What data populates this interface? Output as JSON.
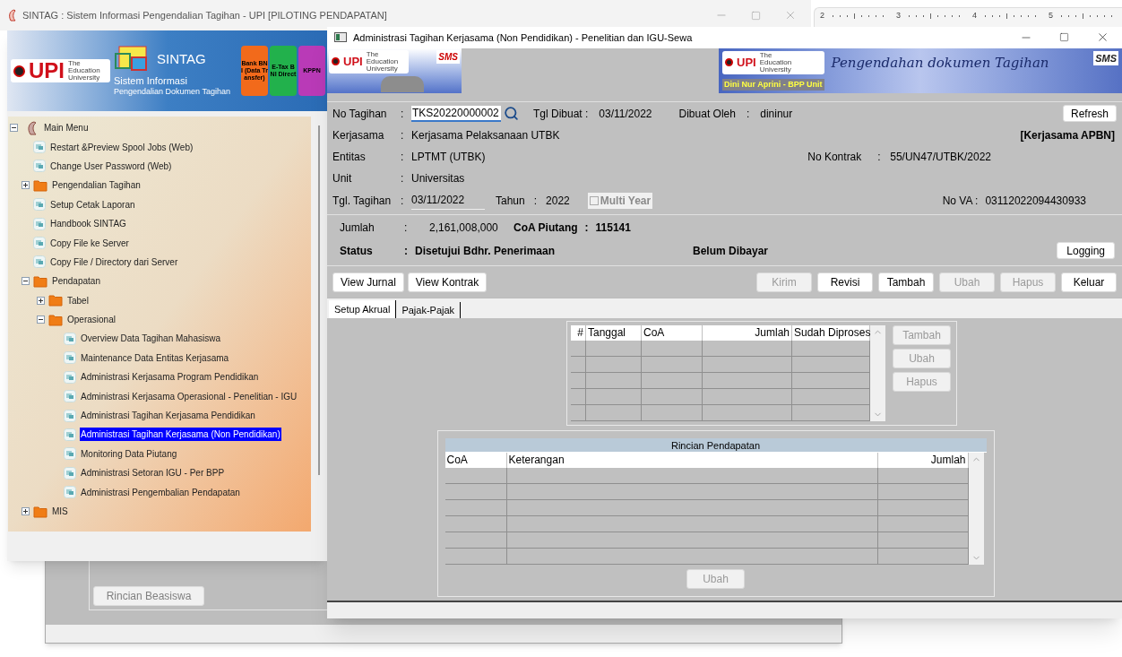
{
  "main_window": {
    "title": "SINTAG : Sistem Informasi Pengendalian Tagihan - UPI [PILOTING PENDAPATAN]",
    "banner": {
      "logo": "UPI",
      "logo_caption": "The Education University",
      "app_name": "SINTAG",
      "subtitle_1": "Sistem Informasi",
      "subtitle_2": "Pengendalian Dokumen Tagihan",
      "tiles": [
        {
          "label": "Bank BNI (Data Transfer)",
          "color": "#f26a1b"
        },
        {
          "label": "E-Tax BNI Direct",
          "color": "#22b14c"
        },
        {
          "label": "KPPN",
          "color": "#b93ab7"
        }
      ]
    },
    "tree": [
      {
        "label": "Main Menu",
        "kind": "root",
        "expanded": true,
        "selected": false,
        "children": [
          {
            "label": "Restart &Preview Spool Jobs (Web)",
            "kind": "page",
            "selected": false
          },
          {
            "label": "Change User Password (Web)",
            "kind": "page",
            "selected": false
          },
          {
            "label": "Pengendalian Tagihan",
            "kind": "folder",
            "expanded": false,
            "selected": false
          },
          {
            "label": "Setup Cetak Laporan",
            "kind": "page",
            "selected": false
          },
          {
            "label": "Handbook SINTAG",
            "kind": "page",
            "selected": false
          },
          {
            "label": "Copy File ke Server",
            "kind": "page",
            "selected": false
          },
          {
            "label": "Copy File / Directory dari Server",
            "kind": "page",
            "selected": false
          },
          {
            "label": "Pendapatan",
            "kind": "folder",
            "expanded": true,
            "selected": false,
            "children": [
              {
                "label": "Tabel",
                "kind": "folder",
                "expanded": false,
                "selected": false
              },
              {
                "label": "Operasional",
                "kind": "folder",
                "expanded": true,
                "selected": false,
                "children": [
                  {
                    "label": "Overview Data Tagihan Mahasiswa",
                    "kind": "page",
                    "selected": false
                  },
                  {
                    "label": "Maintenance Data Entitas Kerjasama",
                    "kind": "page",
                    "selected": false
                  },
                  {
                    "label": "Administrasi Kerjasama Program Pendidikan",
                    "kind": "page",
                    "selected": false
                  },
                  {
                    "label": "Administrasi Kerjasama Operasional - Penelitian - IGU",
                    "kind": "page",
                    "selected": false
                  },
                  {
                    "label": "Administrasi Tagihan Kerjasama Pendidikan",
                    "kind": "page",
                    "selected": false
                  },
                  {
                    "label": "Administrasi Tagihan Kerjasama (Non Pendidikan)",
                    "kind": "page",
                    "selected": true
                  },
                  {
                    "label": "Monitoring Data Piutang",
                    "kind": "page",
                    "selected": false
                  },
                  {
                    "label": "Administrasi Setoran IGU - Per BPP",
                    "kind": "page",
                    "selected": false
                  },
                  {
                    "label": "Administrasi Pengembalian Pendapatan",
                    "kind": "page",
                    "selected": false
                  }
                ]
              }
            ]
          },
          {
            "label": "MIS",
            "kind": "folder",
            "expanded": false,
            "selected": false
          }
        ]
      }
    ]
  },
  "background_window": {
    "button": {
      "label": "Rincian Beasiswa",
      "disabled": true
    }
  },
  "ruler": {
    "marks": [
      "2",
      "3",
      "4",
      "5"
    ]
  },
  "dialog": {
    "title": "Administrasi Tagihan Kerjasama (Non Pendidikan) - Penelitian dan IGU-Sewa",
    "left_banner": {
      "logo": "UPI",
      "logo_caption": "The Education University",
      "partner_logo": "SMS"
    },
    "right_banner": {
      "logo": "UPI",
      "logo_caption": "The Education University",
      "slogan": "Pengendahan dokumen Tagihan",
      "partner_logo": "SMS",
      "user": "Dini Nur Aprini - BPP Unit"
    },
    "no_tagihan": {
      "label": "No Tagihan",
      "colon": ":",
      "value": "TKS20220000002"
    },
    "tgl_dibuat": {
      "label": "Tgl Dibuat :",
      "value": "03/11/2022"
    },
    "dibuat_oleh": {
      "label": "Dibuat Oleh",
      "colon": ":",
      "value": "dininur"
    },
    "refresh_button": "Refresh",
    "kerjasama": {
      "label": "Kerjasama",
      "colon": ":",
      "value": "Kerjasama Pelaksanaan UTBK"
    },
    "kerjasama_type": "[Kerjasama APBN]",
    "entitas": {
      "label": "Entitas",
      "colon": ":",
      "value": "LPTMT (UTBK)"
    },
    "no_kontrak": {
      "label": "No Kontrak",
      "colon": ":",
      "value": "55/UN47/UTBK/2022"
    },
    "unit": {
      "label": "Unit",
      "colon": ":",
      "value": "Universitas"
    },
    "tgl_tagihan": {
      "label": "Tgl. Tagihan",
      "colon": ":",
      "value": "03/11/2022"
    },
    "tahun": {
      "label": "Tahun",
      "colon": ":",
      "value": "2022"
    },
    "multi_year": {
      "label": "Multi Year",
      "checked": false,
      "disabled": true
    },
    "no_va": {
      "label": "No VA :",
      "value": "03112022094430933"
    },
    "jumlah": {
      "label": "Jumlah",
      "colon": ":",
      "value": "2,161,008,000"
    },
    "coa_piutang": {
      "label": "CoA Piutang",
      "colon": ":",
      "value": "115141"
    },
    "status": {
      "label": "Status",
      "colon": ":",
      "value": "Disetujui Bdhr. Penerimaan",
      "payment": "Belum Dibayar"
    },
    "logging_button": "Logging",
    "left_buttons": [
      {
        "label": "View Jurnal",
        "disabled": false
      },
      {
        "label": "View Kontrak",
        "disabled": false
      }
    ],
    "right_buttons": [
      {
        "label": "Kirim",
        "disabled": true
      },
      {
        "label": "Revisi",
        "disabled": false
      },
      {
        "label": "Tambah",
        "disabled": false
      },
      {
        "label": "Ubah",
        "disabled": true
      },
      {
        "label": "Hapus",
        "disabled": true
      },
      {
        "label": "Keluar",
        "disabled": false
      }
    ],
    "tabs": [
      {
        "label": "Setup Akrual",
        "selected": true
      },
      {
        "label": "Pajak-Pajak",
        "selected": false
      }
    ],
    "akrual_table": {
      "columns": [
        {
          "label": "#",
          "kind": "number"
        },
        {
          "label": "Tanggal",
          "kind": "text"
        },
        {
          "label": "CoA",
          "kind": "text"
        },
        {
          "label": "Jumlah",
          "kind": "number"
        },
        {
          "label": "Sudah Diproses",
          "kind": "text"
        }
      ],
      "buttons": [
        {
          "label": "Tambah",
          "disabled": true
        },
        {
          "label": "Ubah",
          "disabled": true
        },
        {
          "label": "Hapus",
          "disabled": true
        }
      ]
    },
    "rincian": {
      "title": "Rincian Pendapatan",
      "columns": [
        {
          "label": "CoA",
          "kind": "text"
        },
        {
          "label": "Keterangan",
          "kind": "text"
        },
        {
          "label": "Jumlah",
          "kind": "number"
        }
      ],
      "button": {
        "label": "Ubah",
        "disabled": true
      }
    }
  }
}
